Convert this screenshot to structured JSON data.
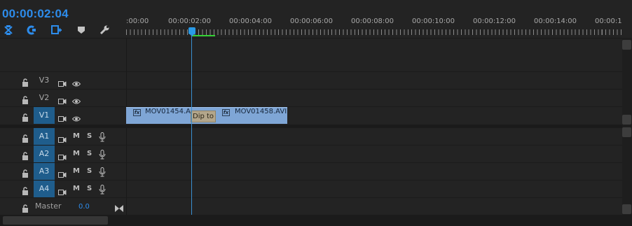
{
  "timeline": {
    "timecode": "00:00:02:04",
    "ruler_labels": [
      ":00:00",
      "00:00:02:00",
      "00:00:04:00",
      "00:00:06:00",
      "00:00:08:00",
      "00:00:10:00",
      "00:00:12:00",
      "00:00:14:00",
      "00:00:1"
    ],
    "playhead_seconds": 2.08
  },
  "tools": [
    {
      "icon": "snap-icon"
    },
    {
      "icon": "linked-selection-icon"
    },
    {
      "icon": "add-marker-icon"
    },
    {
      "icon": "marker-icon"
    },
    {
      "icon": "wrench-icon"
    }
  ],
  "video_tracks": [
    {
      "name": "V3",
      "selected": false
    },
    {
      "name": "V2",
      "selected": false
    },
    {
      "name": "V1",
      "selected": true
    }
  ],
  "audio_tracks": [
    {
      "name": "A1",
      "mute": "M",
      "solo": "S"
    },
    {
      "name": "A2",
      "mute": "M",
      "solo": "S"
    },
    {
      "name": "A3",
      "mute": "M",
      "solo": "S"
    },
    {
      "name": "A4",
      "mute": "M",
      "solo": "S"
    }
  ],
  "master": {
    "name": "Master",
    "value": "0.0"
  },
  "clips": [
    {
      "label": "MOV01454.A",
      "fx": "fx"
    },
    {
      "label": "MOV01458.AVI",
      "fx": "fx"
    }
  ],
  "transition": {
    "label": "Dip to"
  },
  "colors": {
    "accent": "#2d8ceb",
    "clip": "#7fa6d6",
    "transition": "#b3a68b",
    "work_area": "#35d235",
    "background": "#232323"
  }
}
